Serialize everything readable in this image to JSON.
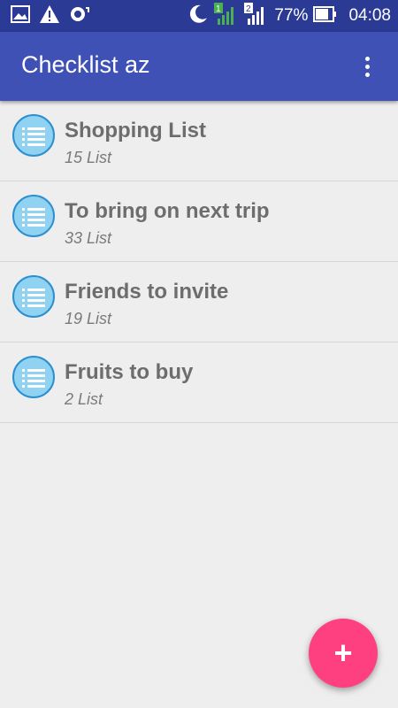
{
  "status_bar": {
    "battery_text": "77%",
    "time": "04:08",
    "sim_labels": [
      "1",
      "2"
    ],
    "icons": [
      "image-icon",
      "warning-icon",
      "sync-icon",
      "moon-icon",
      "signal-icon",
      "signal-icon",
      "battery-icon"
    ]
  },
  "app_bar": {
    "title": "Checklist az",
    "menu_icon": "more-vert-icon"
  },
  "lists": [
    {
      "title": "Shopping List",
      "subtitle": "15 List"
    },
    {
      "title": "To bring on next trip",
      "subtitle": "33 List"
    },
    {
      "title": "Friends to invite",
      "subtitle": "19 List"
    },
    {
      "title": "Fruits to buy",
      "subtitle": "2 List"
    }
  ],
  "fab": {
    "label": "+",
    "icon": "add-icon"
  },
  "colors": {
    "status_bar": "#2a3a95",
    "app_bar": "#3f51b5",
    "background": "#eeeeee",
    "list_icon_fill": "#8fd2f2",
    "list_icon_border": "#2c8fd0",
    "fab": "#fe4081"
  }
}
